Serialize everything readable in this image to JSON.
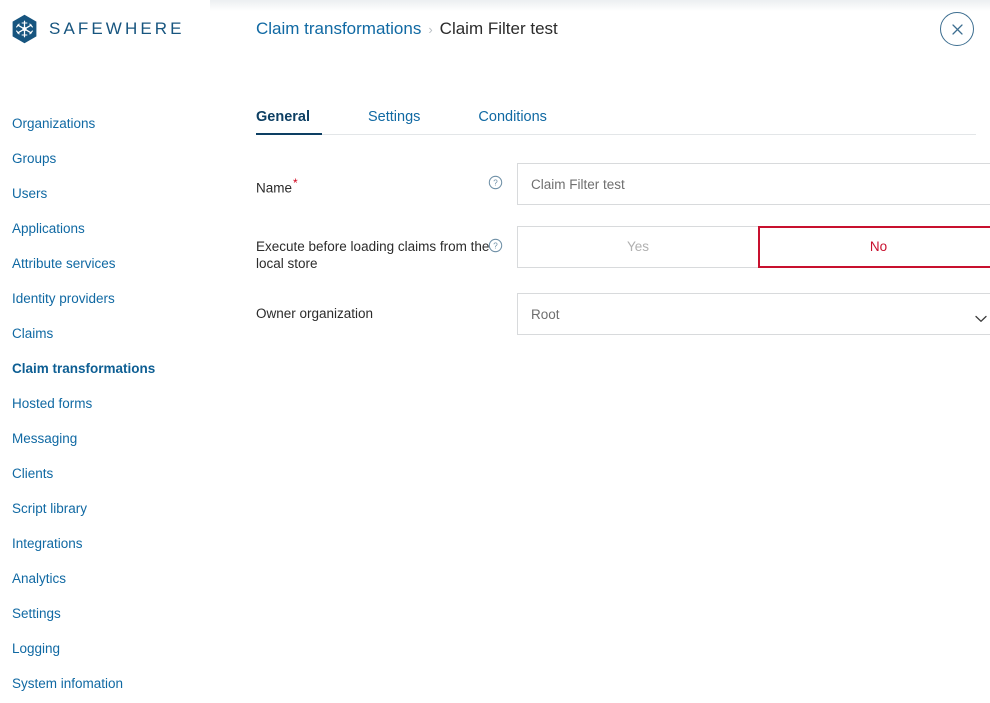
{
  "brand": {
    "name": "SAFEWHERE",
    "logo_icon": "snowflake-hexagon-logo",
    "logo_color": "#17557f"
  },
  "sidebar": {
    "items": [
      {
        "label": "Organizations",
        "active": false
      },
      {
        "label": "Groups",
        "active": false
      },
      {
        "label": "Users",
        "active": false
      },
      {
        "label": "Applications",
        "active": false
      },
      {
        "label": "Attribute services",
        "active": false
      },
      {
        "label": "Identity providers",
        "active": false
      },
      {
        "label": "Claims",
        "active": false
      },
      {
        "label": "Claim transformations",
        "active": true
      },
      {
        "label": "Hosted forms",
        "active": false
      },
      {
        "label": "Messaging",
        "active": false
      },
      {
        "label": "Clients",
        "active": false
      },
      {
        "label": "Script library",
        "active": false
      },
      {
        "label": "Integrations",
        "active": false
      },
      {
        "label": "Analytics",
        "active": false
      },
      {
        "label": "Settings",
        "active": false
      },
      {
        "label": "Logging",
        "active": false
      },
      {
        "label": "System infomation",
        "active": false
      }
    ],
    "link_color": "#1069a3",
    "active_color": "#0d5e93"
  },
  "header": {
    "breadcrumb_parent": "Claim transformations",
    "breadcrumb_separator": "›",
    "breadcrumb_current": "Claim Filter test",
    "close_icon": "close-x-icon",
    "close_color": "#3d6e90"
  },
  "tabs": [
    {
      "label": "General",
      "active": true
    },
    {
      "label": "Settings",
      "active": false
    },
    {
      "label": "Conditions",
      "active": false
    }
  ],
  "tab_accent_color": "#0d3f63",
  "form": {
    "name_field": {
      "label": "Name",
      "required_marker": "*",
      "help_icon": "help-question-icon",
      "value": "Claim Filter test",
      "placeholder": "Claim Filter test"
    },
    "execute_before": {
      "label": "Execute before loading claims from the local store",
      "help_icon": "help-question-icon",
      "options": [
        "Yes",
        "No"
      ],
      "yes_label": "Yes",
      "no_label": "No",
      "selected": "No",
      "selected_color": "#c8102e",
      "unselected_color": "#b0b0b0"
    },
    "owner_organization": {
      "label": "Owner organization",
      "value": "Root",
      "options": [
        "Root"
      ],
      "chevron_icon": "chevron-down-icon"
    }
  }
}
